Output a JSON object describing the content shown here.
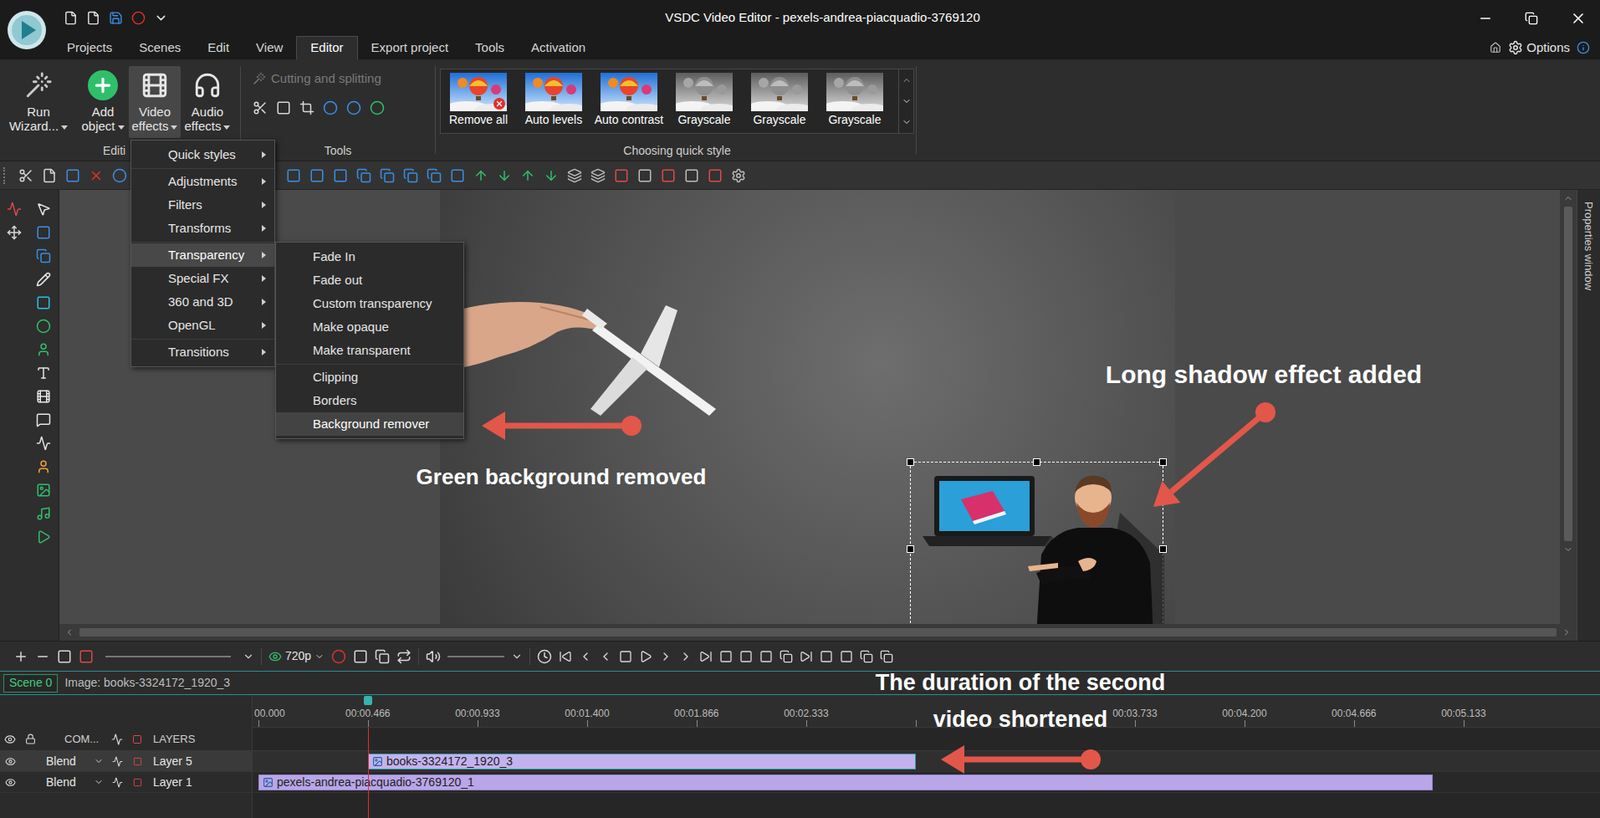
{
  "window": {
    "title": "VSDC Video Editor - pexels-andrea-piacquadio-3769120"
  },
  "menu_tabs": [
    {
      "label": "Projects",
      "selected": false
    },
    {
      "label": "Scenes",
      "selected": false
    },
    {
      "label": "Edit",
      "selected": false
    },
    {
      "label": "View",
      "selected": false
    },
    {
      "label": "Editor",
      "selected": true
    },
    {
      "label": "Export project",
      "selected": false
    },
    {
      "label": "Tools",
      "selected": false
    },
    {
      "label": "Activation",
      "selected": false
    }
  ],
  "options": {
    "label": "Options"
  },
  "ribbon": {
    "editing": {
      "buttons": [
        {
          "lines": [
            "Run",
            "Wizard..."
          ],
          "selected": false,
          "kind": "wizard"
        },
        {
          "lines": [
            "Add",
            "object"
          ],
          "selected": false,
          "kind": "add"
        },
        {
          "lines": [
            "Video",
            "effects"
          ],
          "selected": true,
          "kind": "video"
        },
        {
          "lines": [
            "Audio",
            "effects"
          ],
          "selected": false,
          "kind": "audio"
        }
      ],
      "group_label": "Editi"
    },
    "tools": {
      "cutting": {
        "label": "Cutting and splitting",
        "disabled": true
      },
      "group_label": "Tools"
    },
    "quick_styles": {
      "items": [
        {
          "label": "Remove all",
          "kind": "remove"
        },
        {
          "label": "Auto levels",
          "kind": "color"
        },
        {
          "label": "Auto contrast",
          "kind": "color"
        },
        {
          "label": "Grayscale",
          "kind": "gray"
        },
        {
          "label": "Grayscale",
          "kind": "gray"
        },
        {
          "label": "Grayscale",
          "kind": "gray"
        }
      ],
      "group_label": "Choosing quick style"
    }
  },
  "video_effects_menu": {
    "items": [
      {
        "label": "Quick styles",
        "selected": false,
        "separator_before": false
      },
      {
        "label": "Adjustments",
        "selected": false,
        "separator_before": true
      },
      {
        "label": "Filters",
        "selected": false,
        "separator_before": false
      },
      {
        "label": "Transforms",
        "selected": false,
        "separator_before": false
      },
      {
        "label": "Transparency",
        "selected": true,
        "separator_before": true
      },
      {
        "label": "Special FX",
        "selected": false,
        "separator_before": false
      },
      {
        "label": "360 and 3D",
        "selected": false,
        "separator_before": false
      },
      {
        "label": "OpenGL",
        "selected": false,
        "separator_before": false
      },
      {
        "label": "Transitions",
        "selected": false,
        "separator_before": true
      }
    ]
  },
  "transparency_submenu": {
    "items": [
      {
        "label": "Fade In",
        "selected": false,
        "separator_before": false
      },
      {
        "label": "Fade out",
        "selected": false,
        "separator_before": false
      },
      {
        "label": "Custom transparency",
        "selected": false,
        "separator_before": false
      },
      {
        "label": "Make opaque",
        "selected": false,
        "separator_before": false
      },
      {
        "label": "Make transparent",
        "selected": false,
        "separator_before": false
      },
      {
        "label": "Clipping",
        "selected": false,
        "separator_before": true
      },
      {
        "label": "Borders",
        "selected": false,
        "separator_before": false
      },
      {
        "label": "Background remover",
        "selected": true,
        "separator_before": false
      }
    ]
  },
  "annotations": [
    {
      "lines": [
        "Long shadow effect added"
      ]
    },
    {
      "lines": [
        "Green background removed"
      ]
    },
    {
      "lines": [
        "The duration of the second",
        "video shortened"
      ]
    }
  ],
  "properties_panel": {
    "label": "Properties window"
  },
  "timeline": {
    "resolution": "720p",
    "scene_tab": {
      "label": "Scene 0",
      "selected": true
    },
    "object_label": "Image: books-3324172_1920_3",
    "ticks": [
      "00.000",
      "00:00.466",
      "00:00.933",
      "00:01.400",
      "00:01.866",
      "00:02.333",
      "00:03.733",
      "00:04.200",
      "00:04.666",
      "00:05.133"
    ],
    "header": {
      "com": "COM...",
      "layers": "LAYERS"
    },
    "layers": [
      {
        "blend": "Blend",
        "name": "Layer 5",
        "clip": "books-3324172_1920_3",
        "selected": true,
        "visible": true
      },
      {
        "blend": "Blend",
        "name": "Layer 1",
        "clip": "pexels-andrea-piacquadio-3769120_1",
        "selected": false,
        "visible": true
      }
    ]
  }
}
